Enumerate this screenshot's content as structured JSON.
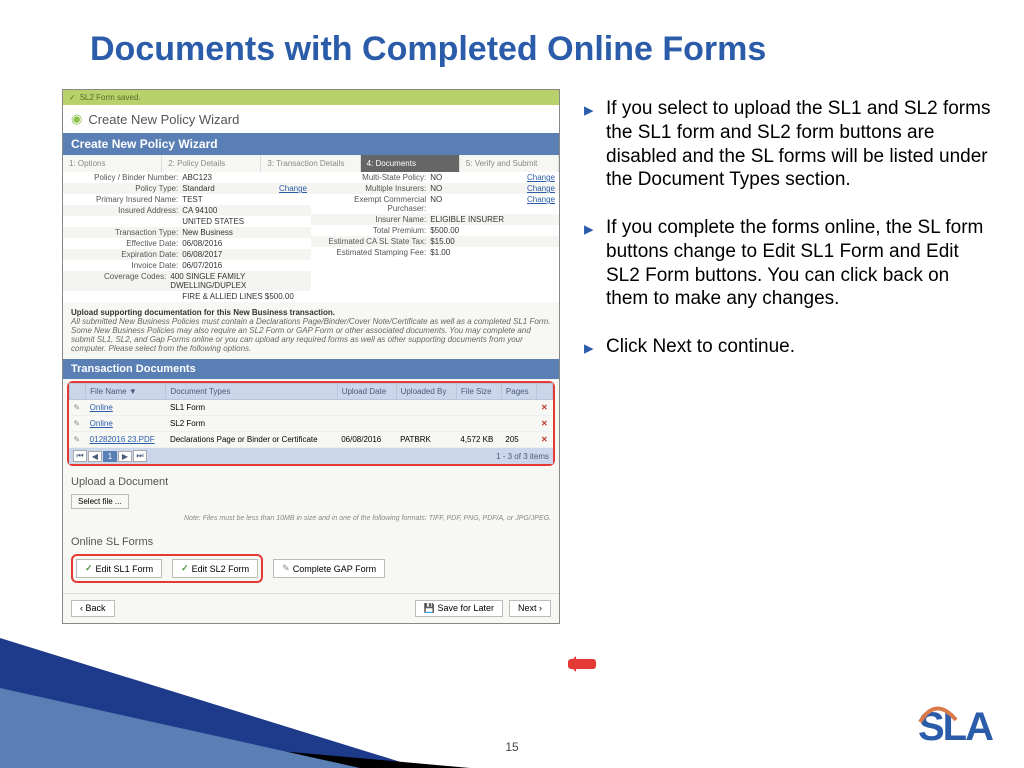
{
  "slideTitle": "Documents with Completed Online Forms",
  "pageNumber": "15",
  "logo": "SLA",
  "bullets": [
    "If you select to upload the SL1 and SL2 forms the SL1 form and SL2 form buttons are disabled and the SL forms will be listed under the Document Types section.",
    "If you complete the forms online, the SL form buttons change to Edit SL1 Form and Edit SL2 Form buttons.  You can click back on them to make any changes.",
    "Click Next to continue."
  ],
  "greenBar": "SL2 Form saved.",
  "wizTitle": "Create New Policy Wizard",
  "wizBar": "Create New Policy Wizard",
  "steps": [
    "1: Options",
    "2: Policy Details",
    "3: Transaction Details",
    "4: Documents",
    "5: Verify and Submit"
  ],
  "leftDetails": [
    {
      "label": "Policy / Binder Number:",
      "val": "ABC123"
    },
    {
      "label": "Policy Type:",
      "val": "Standard",
      "change": true
    },
    {
      "label": "Primary Insured Name:",
      "val": "TEST"
    },
    {
      "label": "Insured Address:",
      "val": "CA 94100"
    },
    {
      "label": "",
      "val": "UNITED STATES"
    },
    {
      "label": "Transaction Type:",
      "val": "New Business"
    },
    {
      "label": "Effective Date:",
      "val": "06/08/2016"
    },
    {
      "label": "Expiration Date:",
      "val": "06/08/2017"
    },
    {
      "label": "Invoice Date:",
      "val": "06/07/2016"
    },
    {
      "label": "Coverage Codes:",
      "val": "400 SINGLE FAMILY DWELLING/DUPLEX"
    },
    {
      "label": "",
      "val": "FIRE & ALLIED LINES $500.00"
    }
  ],
  "rightDetails": [
    {
      "label": "Multi-State Policy:",
      "val": "NO",
      "change": true
    },
    {
      "label": "Multiple Insurers:",
      "val": "NO",
      "change": true
    },
    {
      "label": "Exempt Commercial Purchaser:",
      "val": "NO",
      "change": true
    },
    {
      "label": "Insurer Name:",
      "val": "ELIGIBLE INSURER"
    },
    {
      "label": "Total Premium:",
      "val": "$500.00"
    },
    {
      "label": "Estimated CA SL State Tax:",
      "val": "$15.00"
    },
    {
      "label": "Estimated Stamping Fee:",
      "val": "$1.00"
    }
  ],
  "uploadTitle": "Upload supporting documentation for this New Business transaction.",
  "uploadNote": "All submitted New Business Policies must contain a Declarations Page/Binder/Cover Note/Certificate as well as a completed SL1 Form. Some New Business Policies may also require an SL2 Form or GAP Form or other associated documents. You may complete and submit SL1, SL2, and Gap Forms online or you can upload any required forms as well as other supporting documents from your computer. Please select from the following options.",
  "transDocs": "Transaction Documents",
  "tableHeaders": [
    "",
    "File Name ▼",
    "Document Types",
    "Upload Date",
    "Uploaded By",
    "File Size",
    "Pages",
    ""
  ],
  "rows": [
    {
      "file": "Online",
      "type": "SL1 Form",
      "date": "",
      "by": "",
      "size": "",
      "pages": ""
    },
    {
      "file": "Online",
      "type": "SL2 Form",
      "date": "",
      "by": "",
      "size": "",
      "pages": ""
    },
    {
      "file": "01282016 23.PDF",
      "type": "Declarations Page or Binder or Certificate",
      "date": "06/08/2016",
      "by": "PATBRK",
      "size": "4,572 KB",
      "pages": "205"
    }
  ],
  "pagerText": "1 - 3 of 3 items",
  "uploadDoc": "Upload a Document",
  "selectFile": "Select file ...",
  "formatsNote": "Note: Files must be less than 10MB in size and in one of the following formats: TIFF, PDF, PNG, PDF/A, or JPG/JPEG.",
  "onlineSL": "Online SL Forms",
  "editSL1": "Edit SL1 Form",
  "editSL2": "Edit SL2 Form",
  "completeGAP": "Complete GAP Form",
  "back": "Back",
  "saveLater": "Save for Later",
  "next": "Next",
  "changeText": "Change"
}
